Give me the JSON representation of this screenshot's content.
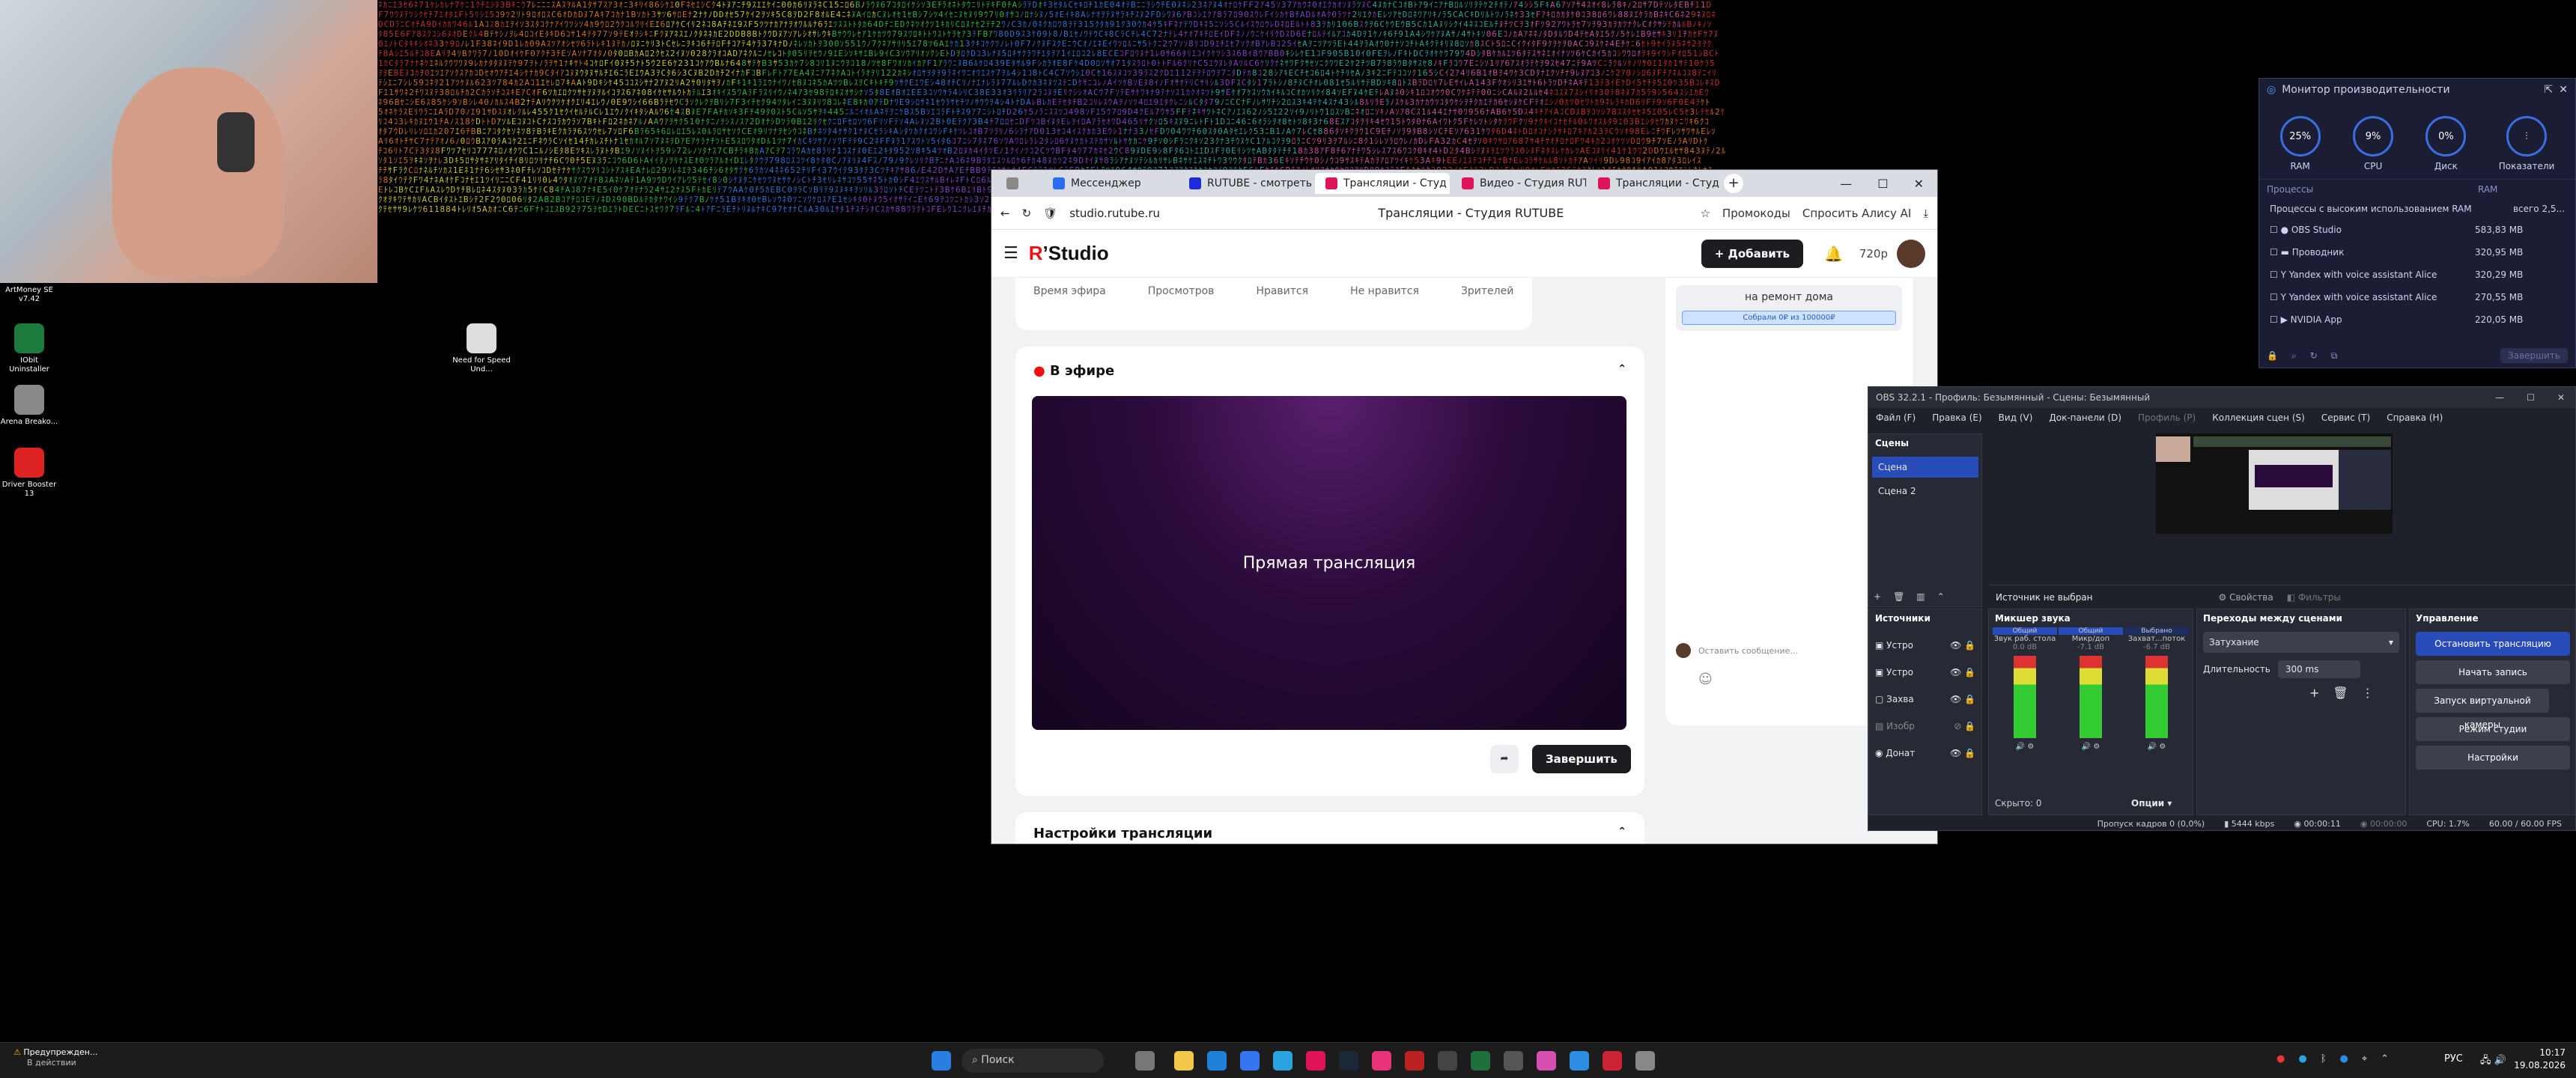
{
  "desktop": {
    "icons": [
      {
        "label": "ArtMoney SE v7.42"
      },
      {
        "label": "IObit Uninstaller"
      },
      {
        "label": "Arena Breako..."
      },
      {
        "label": "Driver Booster 13"
      },
      {
        "label": "Need for Speed Und..."
      }
    ]
  },
  "browser": {
    "tabs": [
      {
        "label": "Мессенджер",
        "color": "#2a6df5"
      },
      {
        "label": "RUTUBE - смотреть о",
        "color": "#1d2bdb"
      },
      {
        "label": "Трансляции - Студ",
        "color": "#e0135a",
        "active": true
      },
      {
        "label": "Видео - Студия RUT",
        "color": "#e0135a"
      },
      {
        "label": "Трансляции - Студ",
        "color": "#e0135a"
      }
    ],
    "url": "studio.rutube.ru",
    "page_title": "Трансляции - Студия RUTUBE",
    "bookmark_promo": "Промокоды",
    "ask_alice": "Спросить Алису AI"
  },
  "studio": {
    "logo_r": "R",
    "logo_text": "Studio",
    "add_button": "Добавить",
    "quality": "720p",
    "stats_headers": [
      "Время эфира",
      "Просмотров",
      "Нравится",
      "Не нравится",
      "Зрителей"
    ],
    "live_label": "В эфире",
    "player_title": "Прямая трансляция",
    "finish_button": "Завершить",
    "settings_title": "Настройки трансляции",
    "donation_title": "на ремонт дома",
    "donation_progress": "Собрали 0₽ из 100000₽",
    "chat_placeholder": "Оставить сообщение..."
  },
  "obs": {
    "title": "OBS 32.2.1 - Профиль: Безымянный - Сцены: Безымянный",
    "menu": [
      "Файл (F)",
      "Правка (E)",
      "Вид (V)",
      "Док-панели (D)",
      "Профиль (P)",
      "Коллекция сцен (S)",
      "Сервис (T)",
      "Справка (H)"
    ],
    "scenes_title": "Сцены",
    "scenes": [
      "Сцена",
      "Сцена 2"
    ],
    "sources_title": "Источники",
    "sources": [
      "Устро",
      "Устро",
      "Захва",
      "Изобр",
      "Донат"
    ],
    "no_source": "Источник не выбран",
    "properties": "Свойства",
    "filters": "Фильтры",
    "mixer_title": "Микшер звука",
    "mixer_channels": [
      {
        "name": "Звук раб. стола",
        "tag": "Общий",
        "db": "0.0 dB"
      },
      {
        "name": "Микр/доп",
        "tag": "Общий",
        "db": "-7.1 dB"
      },
      {
        "name": "Захват...поток",
        "tag": "Выбрано",
        "db": "-6.7 dB"
      }
    ],
    "hidden_label": "Скрыто: 0",
    "options_label": "Опции",
    "transitions_title": "Переходы между сценами",
    "transition_value": "Затухание",
    "duration_label": "Длительность",
    "duration_value": "300 ms",
    "controls_title": "Управление",
    "controls": [
      "Остановить трансляцию",
      "Начать запись",
      "Запуск виртуальной камеры",
      "Режим студии",
      "Настройки"
    ],
    "status": {
      "dropped": "Пропуск кадров 0 (0,0%)",
      "bitrate": "5444 kbps",
      "stream_time": "00:00:11",
      "rec_time": "00:00:00",
      "cpu": "CPU: 1.7%",
      "fps": "60.00 / 60.00 FPS"
    }
  },
  "perf": {
    "title": "Монитор производительности",
    "gauges": [
      {
        "label": "RAM",
        "value": "25%"
      },
      {
        "label": "CPU",
        "value": "9%"
      },
      {
        "label": "Диск",
        "value": "0%"
      },
      {
        "label": "Показатели",
        "value": ""
      }
    ],
    "col_processes": "Процессы",
    "col_ram": "RAM",
    "high_ram": "Процессы с высоким использованием RAM",
    "total": "всего 2,5...",
    "rows": [
      {
        "name": "OBS Studio",
        "ram": "583,83 MB"
      },
      {
        "name": "Проводник",
        "ram": "320,95 MB"
      },
      {
        "name": "Yandex with voice assistant Alice",
        "ram": "320,29 MB"
      },
      {
        "name": "Yandex with voice assistant Alice",
        "ram": "270,55 MB"
      },
      {
        "name": "NVIDIA App",
        "ram": "220,05 MB"
      }
    ],
    "finish": "Завершить"
  },
  "taskbar": {
    "notice_title": "Предупрежден...",
    "notice_sub": "В действии",
    "search": "Поиск",
    "lang": "РУС",
    "time": "10:17",
    "date": "19.08.2026"
  }
}
